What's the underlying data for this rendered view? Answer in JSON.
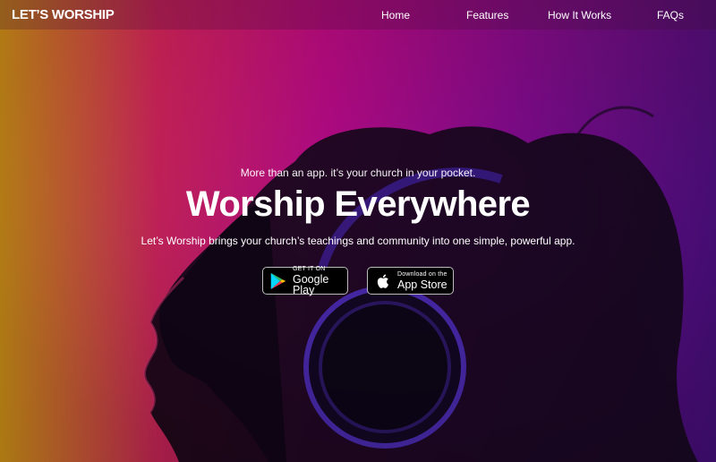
{
  "nav": {
    "logo": "LET’S WORSHIP",
    "links": [
      "Home",
      "Features",
      "How It Works",
      "FAQs"
    ]
  },
  "hero": {
    "tagline": "More than an app. it’s your church in your pocket.",
    "headline": "Worship Everywhere",
    "subtext": "Let’s Worship brings your church’s teachings and community into one simple, powerful app."
  },
  "buttons": {
    "google_play": {
      "small": "GET IT ON",
      "big": "Google Play",
      "icon": "google-play-icon"
    },
    "app_store": {
      "small": "Download on the",
      "big": "App Store",
      "icon": "apple-icon"
    }
  },
  "colors": {
    "gradient_left": "#d2961a",
    "gradient_mid": "#be0a8c",
    "gradient_right": "#460f82",
    "button_bg": "#000000"
  }
}
